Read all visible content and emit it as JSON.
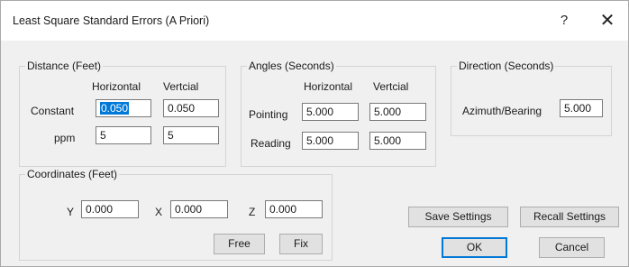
{
  "window": {
    "title": "Least Square Standard Errors (A Priori)",
    "help_label": "?",
    "close_label": "✕"
  },
  "distance": {
    "group_label": "Distance (Feet)",
    "col_horizontal": "Horizontal",
    "col_vertical": "Vertcial",
    "row_constant": "Constant",
    "row_ppm": "ppm",
    "constant_horizontal": "0.050",
    "constant_vertical": "0.050",
    "ppm_horizontal": "5",
    "ppm_vertical": "5"
  },
  "angles": {
    "group_label": "Angles (Seconds)",
    "col_horizontal": "Horizontal",
    "col_vertical": "Vertcial",
    "row_pointing": "Pointing",
    "row_reading": "Reading",
    "pointing_horizontal": "5.000",
    "pointing_vertical": "5.000",
    "reading_horizontal": "5.000",
    "reading_vertical": "5.000"
  },
  "direction": {
    "group_label": "Direction (Seconds)",
    "azimuth_label": "Azimuth/Bearing",
    "azimuth_value": "5.000"
  },
  "coordinates": {
    "group_label": "Coordinates (Feet)",
    "y_label": "Y",
    "y_value": "0.000",
    "x_label": "X",
    "x_value": "0.000",
    "z_label": "Z",
    "z_value": "0.000",
    "free_label": "Free",
    "fix_label": "Fix"
  },
  "buttons": {
    "save_settings": "Save Settings",
    "recall_settings": "Recall Settings",
    "ok": "OK",
    "cancel": "Cancel"
  }
}
